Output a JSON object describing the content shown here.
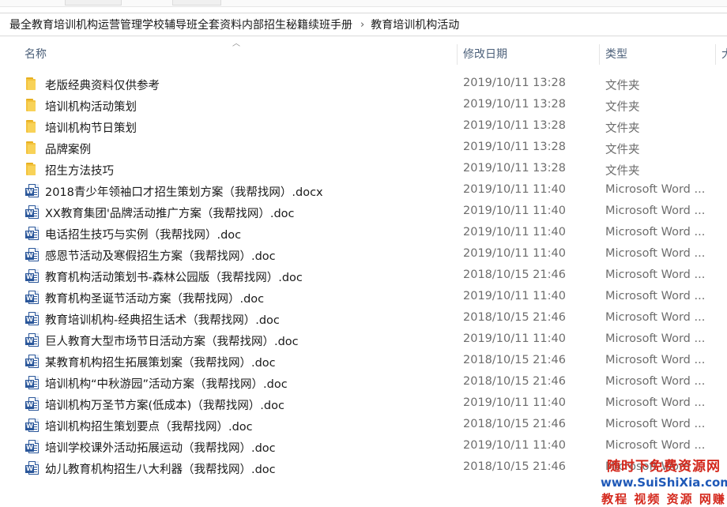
{
  "breadcrumb": {
    "path": "最全教育培训机构运营管理学校辅导班全套资料内部招生秘籍续班手册",
    "separator": "›",
    "current": "教育培训机构活动"
  },
  "columns": {
    "name": "名称",
    "date": "修改日期",
    "type": "类型",
    "size": "大"
  },
  "files": [
    {
      "icon": "folder-icon",
      "name": "老版经典资料仅供参考",
      "date": "2019/10/11 13:28",
      "type": "文件夹"
    },
    {
      "icon": "folder-icon",
      "name": "培训机构活动策划",
      "date": "2019/10/11 13:28",
      "type": "文件夹"
    },
    {
      "icon": "folder-icon",
      "name": "培训机构节日策划",
      "date": "2019/10/11 13:28",
      "type": "文件夹"
    },
    {
      "icon": "folder-icon",
      "name": "品牌案例",
      "date": "2019/10/11 13:28",
      "type": "文件夹"
    },
    {
      "icon": "folder-icon",
      "name": "招生方法技巧",
      "date": "2019/10/11 13:28",
      "type": "文件夹"
    },
    {
      "icon": "word-doc-icon",
      "name": "2018青少年领袖口才招生策划方案（我帮找网）.docx",
      "date": "2019/10/11 11:40",
      "type": "Microsoft Word ..."
    },
    {
      "icon": "word-doc-icon",
      "name": "XX教育集团'品牌活动推广方案（我帮找网）.doc",
      "date": "2019/10/11 11:40",
      "type": "Microsoft Word ..."
    },
    {
      "icon": "word-doc-icon",
      "name": "电话招生技巧与实例（我帮找网）.doc",
      "date": "2019/10/11 11:40",
      "type": "Microsoft Word ..."
    },
    {
      "icon": "word-doc-icon",
      "name": "感恩节活动及寒假招生方案（我帮找网）.doc",
      "date": "2019/10/11 11:40",
      "type": "Microsoft Word ..."
    },
    {
      "icon": "word-doc-icon",
      "name": "教育机构活动策划书-森林公园版（我帮找网）.doc",
      "date": "2018/10/15 21:46",
      "type": "Microsoft Word ..."
    },
    {
      "icon": "word-doc-icon",
      "name": "教育机构圣诞节活动方案（我帮找网）.doc",
      "date": "2019/10/11 11:40",
      "type": "Microsoft Word ..."
    },
    {
      "icon": "word-doc-icon",
      "name": "教育培训机构-经典招生话术（我帮找网）.doc",
      "date": "2018/10/15 21:46",
      "type": "Microsoft Word ..."
    },
    {
      "icon": "word-doc-icon",
      "name": "巨人教育大型市场节日活动方案（我帮找网）.doc",
      "date": "2019/10/11 11:40",
      "type": "Microsoft Word ..."
    },
    {
      "icon": "word-doc-icon",
      "name": "某教育机构招生拓展策划案（我帮找网）.doc",
      "date": "2018/10/15 21:46",
      "type": "Microsoft Word ..."
    },
    {
      "icon": "word-doc-icon",
      "name": "培训机构“中秋游园”活动方案（我帮找网）.doc",
      "date": "2018/10/15 21:46",
      "type": "Microsoft Word ..."
    },
    {
      "icon": "word-doc-icon",
      "name": "培训机构万圣节方案(低成本)（我帮找网）.doc",
      "date": "2019/10/11 11:40",
      "type": "Microsoft Word ..."
    },
    {
      "icon": "word-doc-icon",
      "name": "培训机构招生策划要点（我帮找网）.doc",
      "date": "2018/10/15 21:46",
      "type": "Microsoft Word ..."
    },
    {
      "icon": "word-doc-icon",
      "name": "培训学校课外活动拓展运动（我帮找网）.doc",
      "date": "2019/10/11 11:40",
      "type": "Microsoft Word ..."
    },
    {
      "icon": "word-doc-icon",
      "name": "幼儿教育机构招生八大利器（我帮找网）.doc",
      "date": "2018/10/15 21:46",
      "type": "Microsoft Word ..."
    }
  ],
  "watermark": {
    "line1": "随时下免费资源网",
    "line2": "www.SuiShiXia.com",
    "line3": "教程 视频 资源 网赚"
  }
}
